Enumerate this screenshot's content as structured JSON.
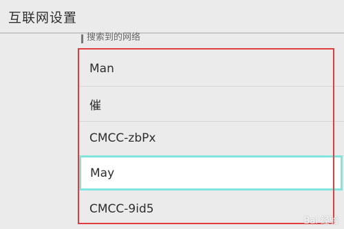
{
  "header": {
    "title": "互联网设置"
  },
  "section": {
    "label": "搜索到的网络"
  },
  "networks": [
    {
      "name": "Man"
    },
    {
      "name": "催"
    },
    {
      "name": "CMCC-zbPx"
    },
    {
      "name": "May"
    },
    {
      "name": "CMCC-9id5"
    }
  ],
  "watermark": "Bai 经验",
  "colors": {
    "highlight": "#7fe6dd",
    "annotation": "#e23b3b"
  }
}
